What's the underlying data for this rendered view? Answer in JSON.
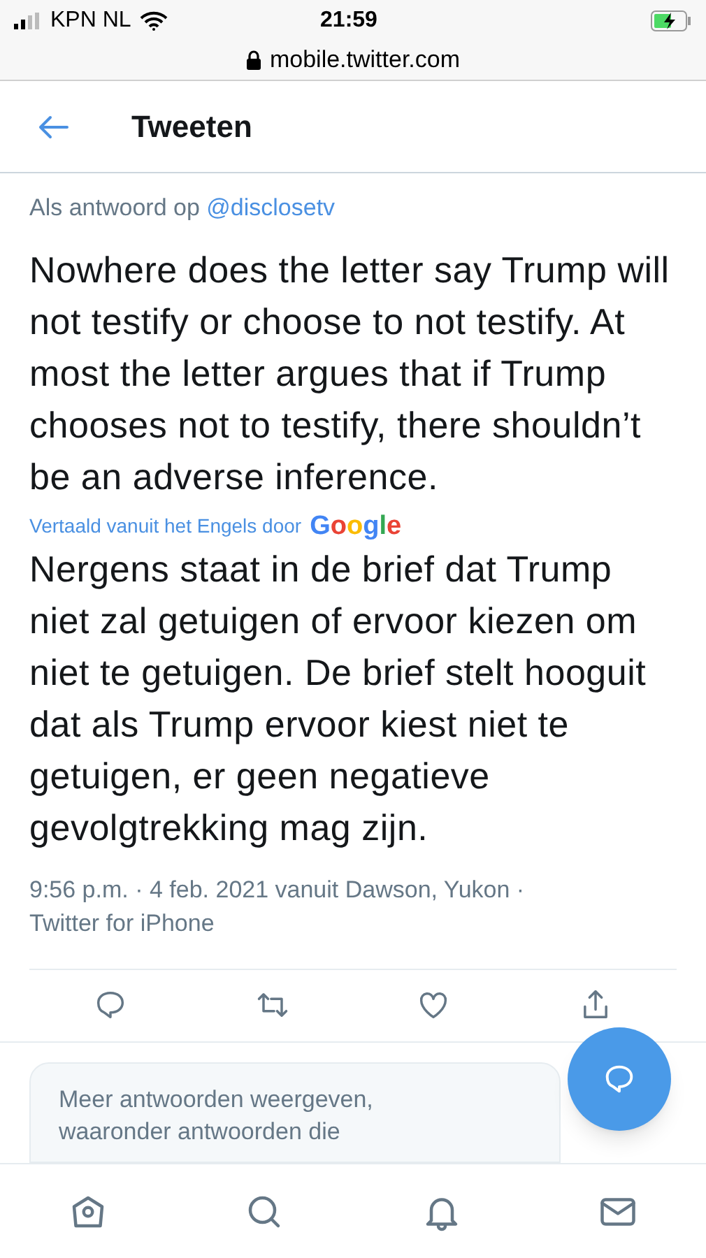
{
  "status_bar": {
    "carrier": "KPN NL",
    "time": "21:59",
    "url": "mobile.twitter.com"
  },
  "header": {
    "title": "Tweeten"
  },
  "tweet": {
    "reply_prefix": "Als antwoord op",
    "reply_to": "@disclosetv",
    "text": "Nowhere does the letter say Trump will not testify or choose to not testify. At most the letter argues that if Trump chooses not to testify, there shouldn’t be an adverse inference.",
    "translation_label": "Vertaald vanuit het Engels door",
    "translation_provider": "Google",
    "translated_text": "Nergens staat in de brief dat Trump niet zal getuigen of ervoor kiezen om niet te getuigen. De brief stelt hooguit dat als Trump ervoor kiest niet te getuigen, er geen negatieve gevolgtrekking mag zijn.",
    "meta": "9:56 p.m. · 4 feb. 2021 vanuit Dawson, Yukon · Twitter for iPhone"
  },
  "more_replies": {
    "text": "Meer antwoorden weergeven, waaronder antwoorden die"
  },
  "bottom_nav": [
    {
      "kind": "home",
      "selected": false
    },
    {
      "kind": "search",
      "selected": false
    },
    {
      "kind": "notifications",
      "selected": false
    },
    {
      "kind": "messages",
      "selected": false
    }
  ]
}
